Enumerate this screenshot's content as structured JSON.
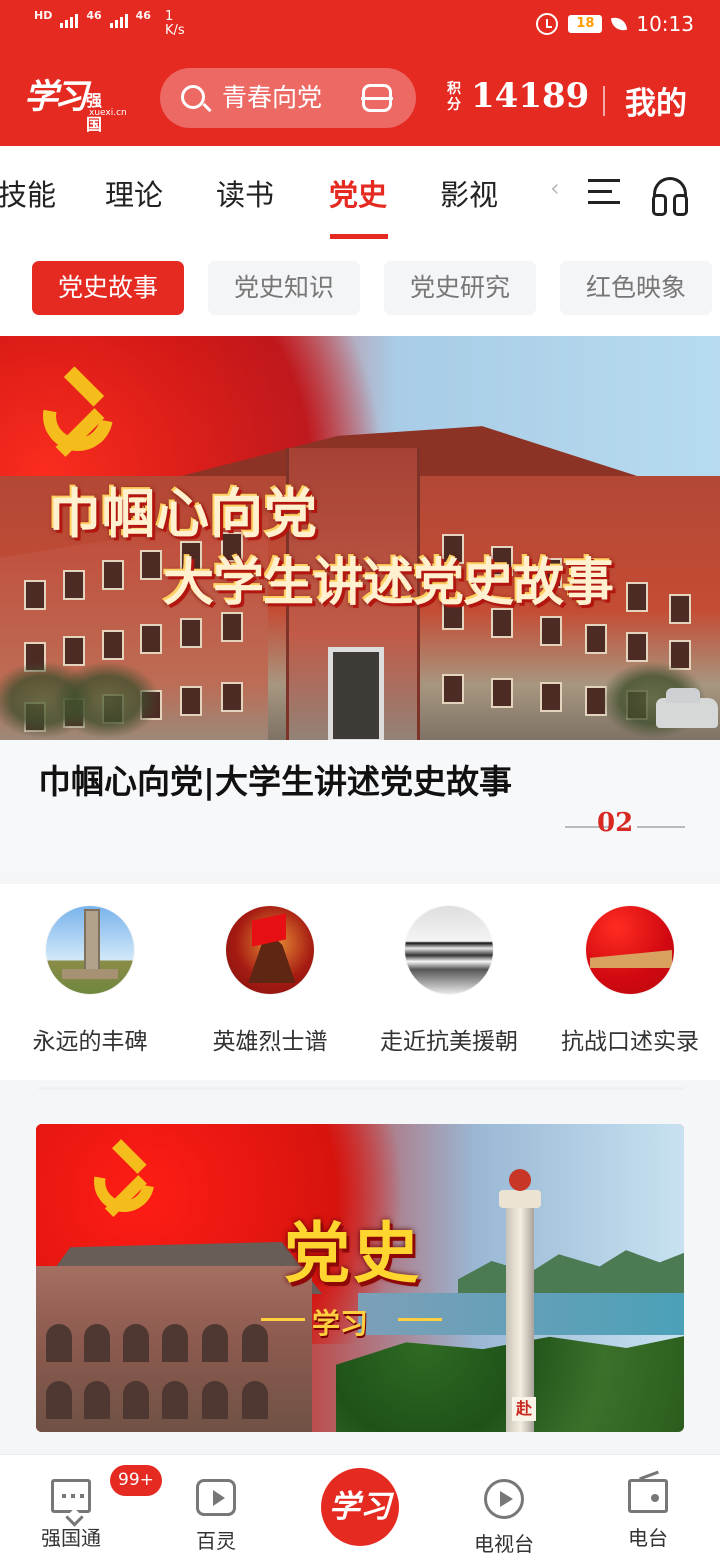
{
  "status": {
    "signals": [
      "HD",
      "46",
      "46"
    ],
    "speed": "1\nK/s",
    "battery": "18",
    "time": "10:13"
  },
  "header": {
    "logo_script": "学习",
    "logo_brand": "强国",
    "logo_site": "xuexi.cn",
    "search_query": "青春向党",
    "score_label": "积分",
    "score": "14189",
    "mine": "我的"
  },
  "tabs": [
    {
      "label": "技能",
      "active": false
    },
    {
      "label": "理论",
      "active": false
    },
    {
      "label": "读书",
      "active": false
    },
    {
      "label": "党史",
      "active": true
    },
    {
      "label": "影视",
      "active": false
    }
  ],
  "subtabs": [
    {
      "label": "党史故事",
      "active": true
    },
    {
      "label": "党史知识",
      "active": false
    },
    {
      "label": "党史研究",
      "active": false
    },
    {
      "label": "红色映象",
      "active": false
    }
  ],
  "hero": {
    "title_line1": "巾帼心向党",
    "title_line2": "大学生讲述党史故事",
    "caption": "巾帼心向党|大学生讲述党史故事",
    "page_number": "02"
  },
  "quick_links": [
    {
      "label": "永远的丰碑",
      "icon": "monument-icon"
    },
    {
      "label": "英雄烈士谱",
      "icon": "hero-statue-icon"
    },
    {
      "label": "走近抗美援朝",
      "icon": "river-crossing-icon"
    },
    {
      "label": "抗战口述实录",
      "icon": "great-wall-flag-icon"
    }
  ],
  "banner2": {
    "title": "党史",
    "subtitle": "学习",
    "monument_inscription": "赴"
  },
  "bottom_nav": [
    {
      "label": "强国通",
      "badge": "99+"
    },
    {
      "label": "百灵"
    },
    {
      "label": "学习"
    },
    {
      "label": "电视台"
    },
    {
      "label": "电台"
    }
  ],
  "colors": {
    "primary_red": "#e52a21",
    "gold": "#f4bd1c"
  }
}
